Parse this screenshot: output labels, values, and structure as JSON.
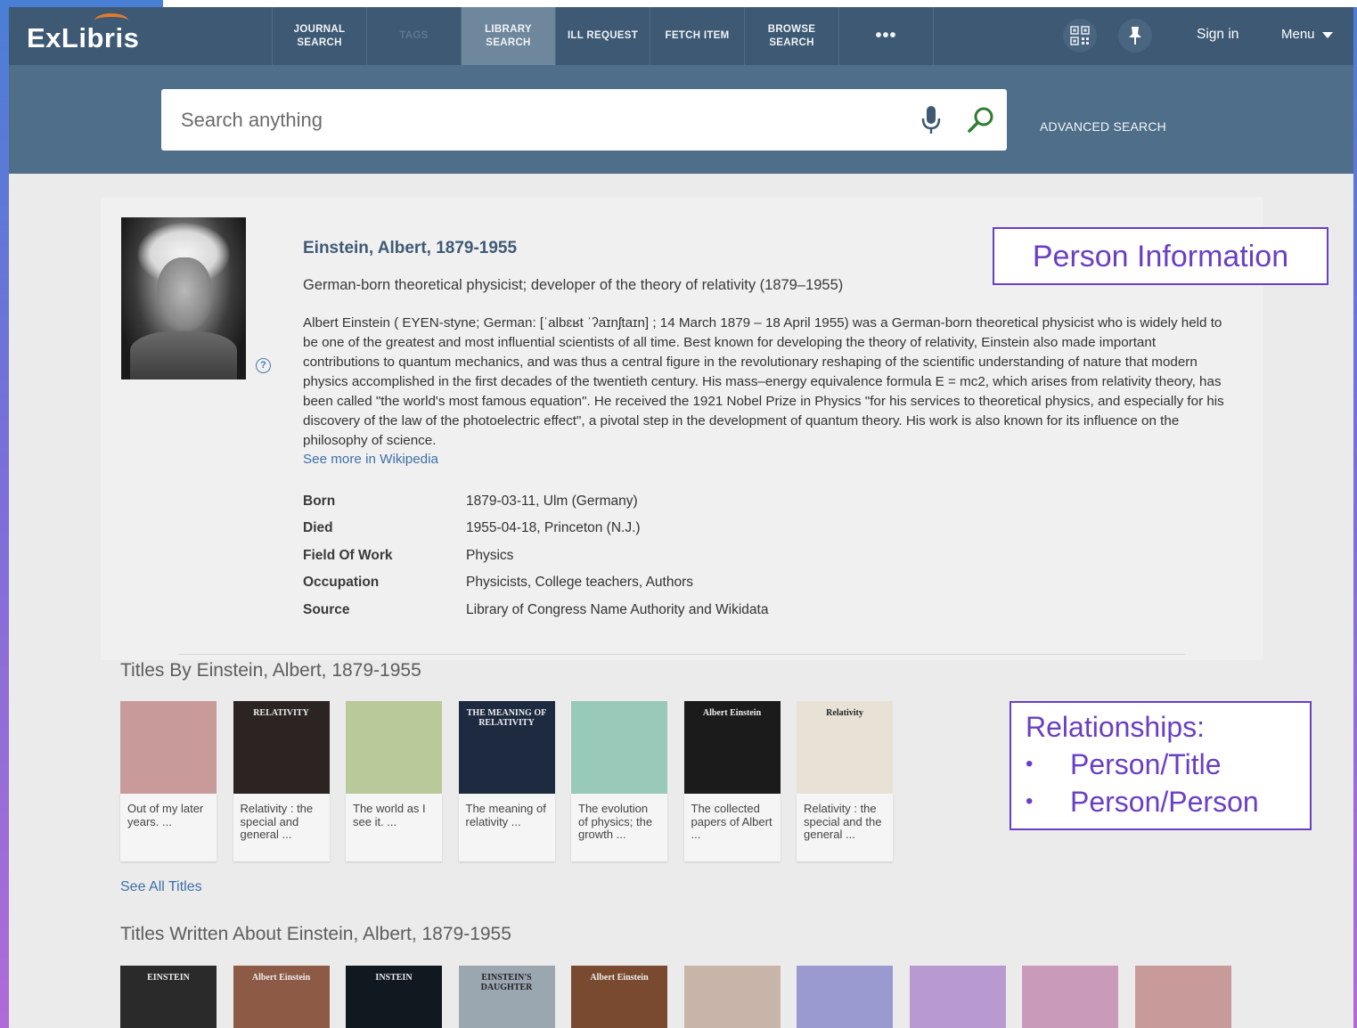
{
  "app": {
    "logo": "ExLibris"
  },
  "nav": {
    "items": [
      {
        "label": "JOURNAL\nSEARCH",
        "state": "normal"
      },
      {
        "label": "TAGS",
        "state": "faded"
      },
      {
        "label": "LIBRARY\nSEARCH",
        "state": "active"
      },
      {
        "label": "ILL REQUEST",
        "state": "normal"
      },
      {
        "label": "FETCH ITEM",
        "state": "normal"
      },
      {
        "label": "BROWSE\nSEARCH",
        "state": "normal"
      },
      {
        "label": "•••",
        "state": "more"
      }
    ],
    "sign_in": "Sign in",
    "menu": "Menu"
  },
  "search": {
    "placeholder": "Search anything",
    "advanced": "ADVANCED SEARCH"
  },
  "person": {
    "name": "Einstein, Albert, 1879-1955",
    "description": "German-born theoretical physicist; developer of the theory of relativity (1879–1955)",
    "bio": "Albert Einstein ( EYEN-styne; German: [ˈalbɛʁt ˈʔaɪnʃtaɪn] ; 14 March 1879 – 18 April 1955) was a German-born theoretical physicist who is widely held to be one of the greatest and most influential scientists of all time. Best known for developing the theory of relativity, Einstein also made important contributions to quantum mechanics, and was thus a central figure in the revolutionary reshaping of the scientific understanding of nature that modern physics accomplished in the first decades of the twentieth century. His mass–energy equivalence formula E = mc2, which arises from relativity theory, has been called \"the world's most famous equation\". He received the 1921 Nobel Prize in Physics \"for his services to theoretical physics, and especially for his discovery of the law of the photoelectric effect\", a pivotal step in the development of quantum theory. His work is also known for its influence on the philosophy of science.",
    "wiki_link": "See more in Wikipedia",
    "facts": [
      {
        "label": "Born",
        "value": "1879-03-11, Ulm (Germany)"
      },
      {
        "label": "Died",
        "value": "1955-04-18, Princeton (N.J.)"
      },
      {
        "label": "Field Of Work",
        "value": "Physics"
      },
      {
        "label": "Occupation",
        "value": "Physicists, College teachers, Authors"
      },
      {
        "label": "Source",
        "value": "Library of Congress Name Authority and Wikidata"
      }
    ]
  },
  "annotations": {
    "person_info": "Person Information",
    "relationships_title": "Relationships:",
    "relationships": [
      "Person/Title",
      "Person/Person"
    ]
  },
  "titles_by": {
    "heading": "Titles By Einstein, Albert, 1879-1955",
    "see_all": "See All Titles",
    "items": [
      {
        "caption": "Out of my later years. ...",
        "color": "#c99a9a"
      },
      {
        "caption": "Relativity : the special and general ...",
        "color": "#2b2422",
        "cover_text": "RELATIVITY"
      },
      {
        "caption": "The world as I see it. ...",
        "color": "#b9c99a"
      },
      {
        "caption": "The meaning of relativity ...",
        "color": "#1d2a40",
        "cover_text": "THE MEANING OF RELATIVITY"
      },
      {
        "caption": "The evolution of physics; the growth ...",
        "color": "#99c9b9"
      },
      {
        "caption": "The collected papers of Albert ...",
        "color": "#1b1b1b",
        "cover_text": "Albert Einstein"
      },
      {
        "caption": "Relativity : the special and the general ...",
        "color": "#e8e2d6",
        "cover_text": "Relativity"
      }
    ]
  },
  "titles_about": {
    "heading": "Titles Written About Einstein, Albert, 1879-1955",
    "items": [
      {
        "color": "#2a2a2a",
        "cover_text": "EINSTEIN"
      },
      {
        "color": "#8c5a45",
        "cover_text": "Albert Einstein"
      },
      {
        "color": "#101820",
        "cover_text": "INSTEIN"
      },
      {
        "color": "#9aa6b0",
        "cover_text": "EINSTEIN'S DAUGHTER"
      },
      {
        "color": "#7a4a30",
        "cover_text": "Albert Einstein"
      },
      {
        "color": "#c8b4a8",
        "cover_text": ""
      },
      {
        "color": "#9a9ad0",
        "cover_text": ""
      },
      {
        "color": "#b89ad0",
        "cover_text": ""
      },
      {
        "color": "#c99ab9",
        "cover_text": ""
      },
      {
        "color": "#c99a9a",
        "cover_text": ""
      }
    ]
  }
}
